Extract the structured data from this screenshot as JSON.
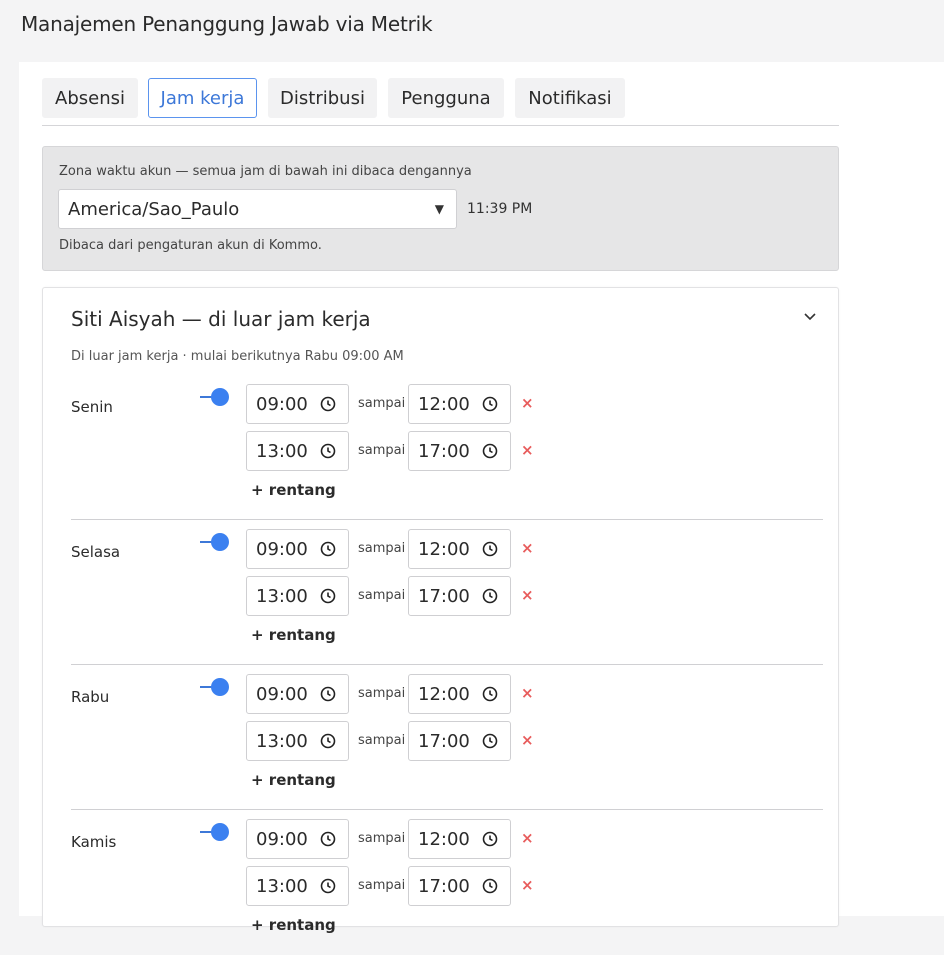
{
  "page": {
    "title": "Manajemen Penanggung Jawab via Metrik"
  },
  "tabs": [
    {
      "label": "Absensi",
      "active": false
    },
    {
      "label": "Jam kerja",
      "active": true
    },
    {
      "label": "Distribusi",
      "active": false
    },
    {
      "label": "Pengguna",
      "active": false
    },
    {
      "label": "Notifikasi",
      "active": false
    }
  ],
  "timezone": {
    "caption": "Zona waktu akun — semua jam di bawah ini dibaca dengannya",
    "selected": "America/Sao_Paulo",
    "current_time": "11:39 PM",
    "note": "Dibaca dari pengaturan akun di Kommo."
  },
  "schedule": {
    "title": "Siti Aisyah — di luar jam kerja",
    "subtitle": "Di luar jam kerja · mulai berikutnya Rabu 09:00 AM",
    "separator": "sampai",
    "add_range": "+ rentang",
    "remove_symbol": "×",
    "days": [
      {
        "name": "Senin",
        "enabled": true,
        "ranges": [
          {
            "from": "09:00",
            "to": "12:00"
          },
          {
            "from": "13:00",
            "to": "17:00"
          }
        ]
      },
      {
        "name": "Selasa",
        "enabled": true,
        "ranges": [
          {
            "from": "09:00",
            "to": "12:00"
          },
          {
            "from": "13:00",
            "to": "17:00"
          }
        ]
      },
      {
        "name": "Rabu",
        "enabled": true,
        "ranges": [
          {
            "from": "09:00",
            "to": "12:00"
          },
          {
            "from": "13:00",
            "to": "17:00"
          }
        ]
      },
      {
        "name": "Kamis",
        "enabled": true,
        "ranges": [
          {
            "from": "09:00",
            "to": "12:00"
          },
          {
            "from": "13:00",
            "to": "17:00"
          }
        ]
      }
    ]
  },
  "colors": {
    "accent": "#3b80f0",
    "remove": "#e85c5c",
    "tz_box_bg": "#e6e6e7"
  }
}
